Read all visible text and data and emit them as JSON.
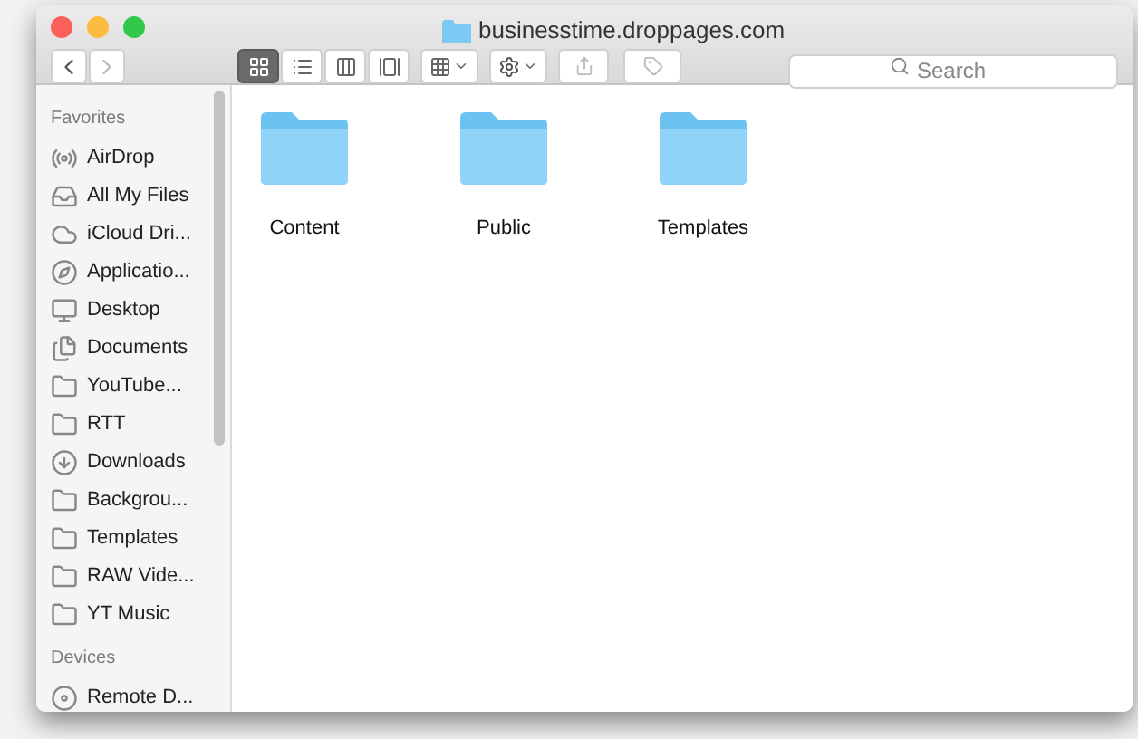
{
  "window": {
    "title": "businesstime.droppages.com"
  },
  "toolbar": {
    "view_modes": [
      {
        "kind": "icons",
        "selected": true
      },
      {
        "kind": "list",
        "selected": false
      },
      {
        "kind": "columns",
        "selected": false
      },
      {
        "kind": "cover",
        "selected": false
      }
    ],
    "search": {
      "placeholder": "Search"
    }
  },
  "sidebar": {
    "sections": [
      {
        "title": "Favorites",
        "items": [
          {
            "label": "AirDrop",
            "kind": "airdrop"
          },
          {
            "label": "All My Files",
            "kind": "files"
          },
          {
            "label": "iCloud Dri...",
            "kind": "cloud"
          },
          {
            "label": "Applicatio...",
            "kind": "apps"
          },
          {
            "label": "Desktop",
            "kind": "desktop"
          },
          {
            "label": "Documents",
            "kind": "documents"
          },
          {
            "label": "YouTube...",
            "kind": "folder"
          },
          {
            "label": "RTT",
            "kind": "folder"
          },
          {
            "label": "Downloads",
            "kind": "downloads"
          },
          {
            "label": "Backgrou...",
            "kind": "folder"
          },
          {
            "label": "Templates",
            "kind": "folder"
          },
          {
            "label": "RAW Vide...",
            "kind": "folder"
          },
          {
            "label": "YT Music",
            "kind": "folder"
          }
        ]
      },
      {
        "title": "Devices",
        "items": [
          {
            "label": "Remote D...",
            "kind": "disc"
          }
        ]
      }
    ]
  },
  "files": [
    {
      "name": "Content"
    },
    {
      "name": "Public"
    },
    {
      "name": "Templates"
    }
  ]
}
